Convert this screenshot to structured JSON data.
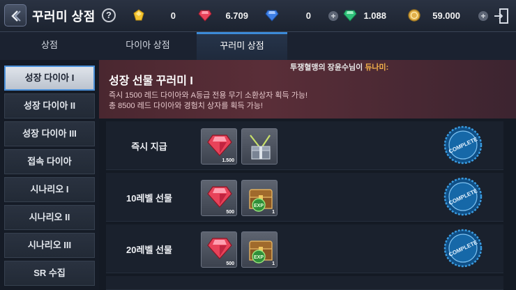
{
  "header": {
    "title": "꾸러미 상점",
    "help_glyph": "?",
    "currencies": [
      {
        "name": "gold-gem",
        "value": "0",
        "color": "#f4c430"
      },
      {
        "name": "red-diamond",
        "value": "6.709",
        "color": "#e8435a"
      },
      {
        "name": "blue-diamond",
        "value": "0",
        "color": "#3e7fe6"
      },
      {
        "name": "green-gem",
        "value": "1.088",
        "color": "#2fc07a"
      },
      {
        "name": "gold-coin",
        "value": "59.000",
        "color": "#e2b04a"
      }
    ],
    "plus_glyph": "+"
  },
  "tabs": [
    {
      "label": "상점",
      "active": false
    },
    {
      "label": "다이아 상점",
      "active": false
    },
    {
      "label": "꾸러미 상점",
      "active": true
    }
  ],
  "sidebar": {
    "items": [
      {
        "label": "성장 다이아 I",
        "active": true
      },
      {
        "label": "성장 다이아 II",
        "active": false
      },
      {
        "label": "성장 다이아 III",
        "active": false
      },
      {
        "label": "접속 다이아",
        "active": false
      },
      {
        "label": "시나리오 I",
        "active": false
      },
      {
        "label": "시나리오 II",
        "active": false
      },
      {
        "label": "시나리오 III",
        "active": false
      },
      {
        "label": "SR 수집",
        "active": false
      }
    ]
  },
  "banner": {
    "marquee_prefix": "투쟁혈맹의 장윤수님이 ",
    "marquee_highlight": "듀나미:",
    "title": "성장 선물 꾸러미 I",
    "desc_line1": "즉시 1500 레드 다이아와 A등급 전용 무기 소환상자 획득 가능!",
    "desc_line2": "총 8500 레드 다이아와 경험치 상자를 획득 가능!"
  },
  "rows": [
    {
      "label": "즉시 지급",
      "item1_qty": "1.500",
      "item2_qty": "",
      "item2_icon": "weapon-box-icon",
      "status": "COMPLETE"
    },
    {
      "label": "10레벨 선물",
      "item1_qty": "500",
      "item2_qty": "1",
      "item2_icon": "exp-chest-icon",
      "status": "COMPLETE"
    },
    {
      "label": "20레벨 선물",
      "item1_qty": "500",
      "item2_qty": "1",
      "item2_icon": "exp-chest-icon",
      "status": "COMPLETE"
    }
  ],
  "exp_badge": "EXP"
}
